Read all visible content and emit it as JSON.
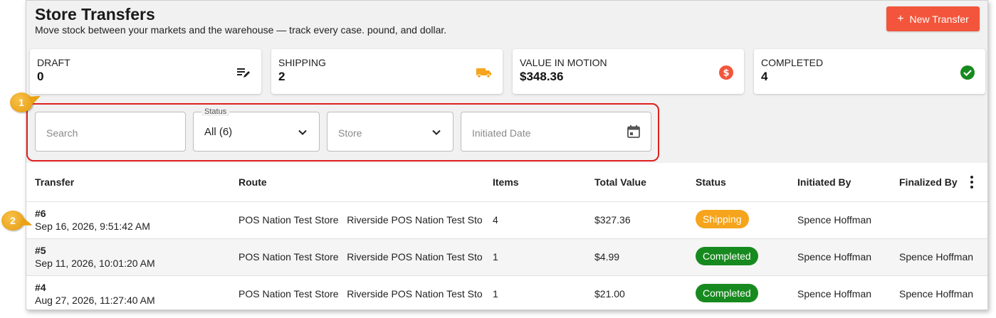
{
  "header": {
    "title": "Store Transfers",
    "subtitle": "Move stock between your markets and the warehouse — track every case. pound, and dollar.",
    "new_button": "New Transfer",
    "new_button_icon": "+"
  },
  "stats": [
    {
      "label": "DRAFT",
      "value": "0",
      "icon": "edit-list-icon",
      "color": "#222222"
    },
    {
      "label": "SHIPPING",
      "value": "2",
      "icon": "truck-icon",
      "color": "#f5a41c"
    },
    {
      "label": "VALUE IN MOTION",
      "value": "$348.36",
      "icon": "dollar-circle-icon",
      "color": "#f2553b"
    },
    {
      "label": "COMPLETED",
      "value": "4",
      "icon": "check-circle-icon",
      "color": "#178a1f"
    }
  ],
  "filters": {
    "search_placeholder": "Search",
    "status_label": "Status",
    "status_value": "All (6)",
    "store_placeholder": "Store",
    "date_placeholder": "Initiated Date"
  },
  "table": {
    "columns": [
      "Transfer",
      "Route",
      "Items",
      "Total Value",
      "Status",
      "Initiated By",
      "Finalized By"
    ],
    "rows": [
      {
        "number": "#6",
        "date": "Sep 16, 2026, 9:51:42 AM",
        "route_from": "POS Nation Test Store",
        "route_to": "Riverside POS Nation Test Store",
        "items": "4",
        "total": "$327.36",
        "status": "Shipping",
        "initiated_by": "Spence Hoffman",
        "finalized_by": ""
      },
      {
        "number": "#5",
        "date": "Sep 11, 2026, 10:01:20 AM",
        "route_from": "POS Nation Test Store",
        "route_to": "Riverside POS Nation Test Store",
        "items": "1",
        "total": "$4.99",
        "status": "Completed",
        "initiated_by": "Spence Hoffman",
        "finalized_by": "Spence Hoffman"
      },
      {
        "number": "#4",
        "date": "Aug 27, 2026, 11:27:40 AM",
        "route_from": "POS Nation Test Store",
        "route_to": "Riverside POS Nation Test Store",
        "items": "1",
        "total": "$21.00",
        "status": "Completed",
        "initiated_by": "Spence Hoffman",
        "finalized_by": "Spence Hoffman"
      }
    ]
  },
  "callouts": [
    "1",
    "2"
  ],
  "colors": {
    "accent": "#f2553b",
    "shipping": "#f5a41c",
    "completed": "#178a1f",
    "highlight": "#e02020",
    "callout": "#f0a91e"
  }
}
